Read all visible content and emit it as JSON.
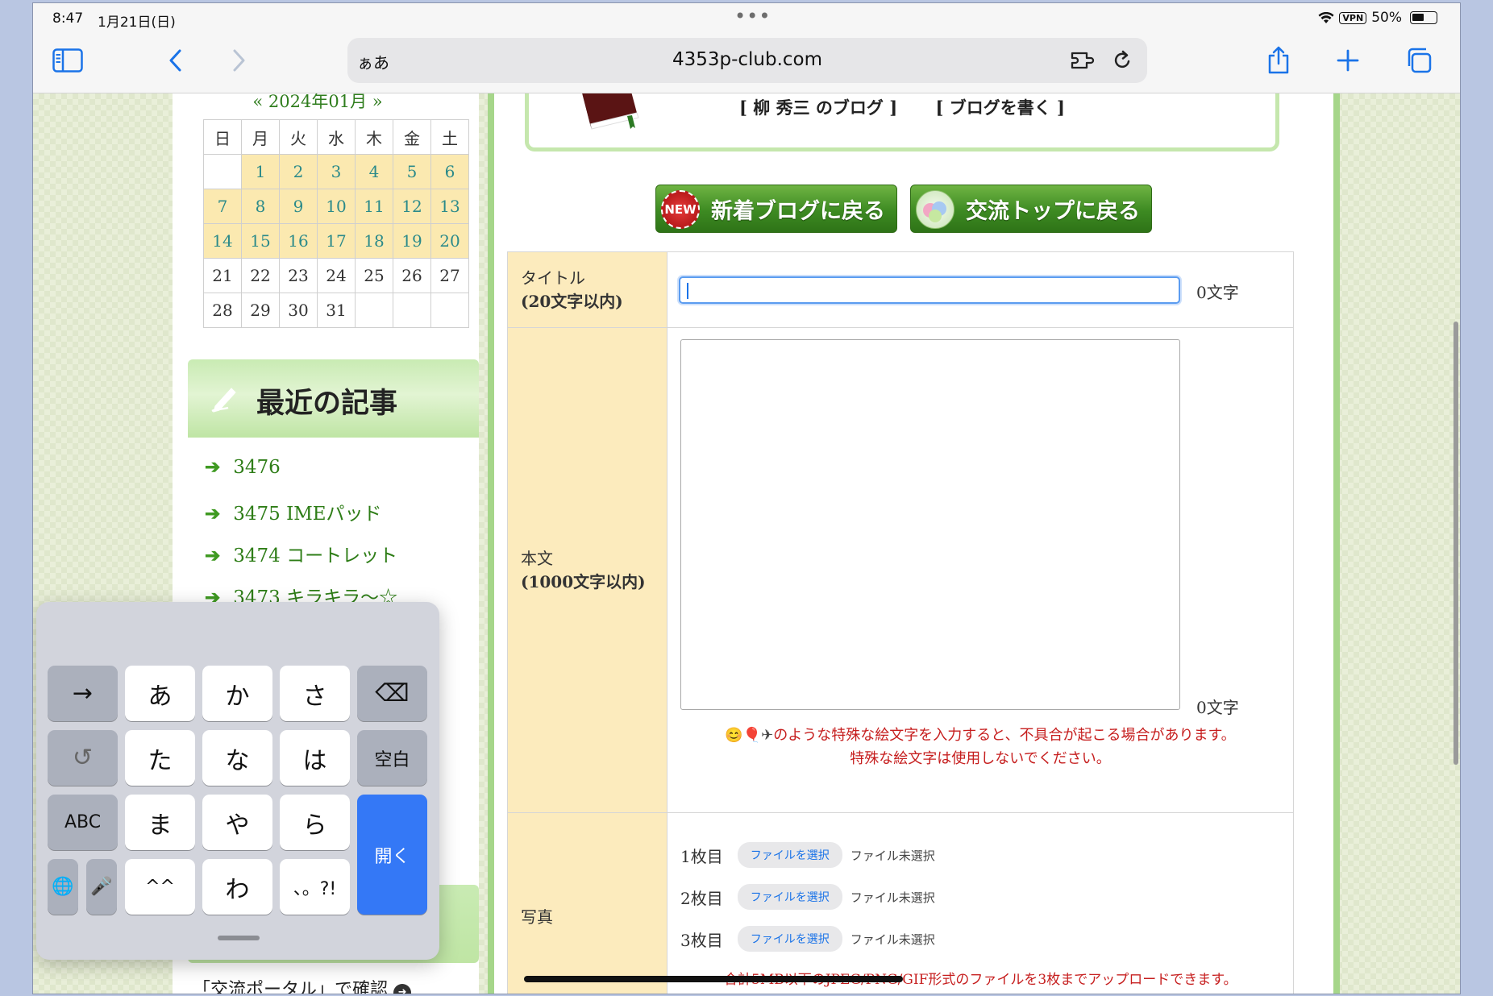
{
  "status_bar": {
    "time": "8:47",
    "date": "1月21日(日)",
    "vpn": "VPN",
    "battery": "50%"
  },
  "browser": {
    "aa_label": "ぁあ",
    "url": "4353p-club.com"
  },
  "calendar": {
    "title": "« 2024年01月 »",
    "weekdays": [
      "日",
      "月",
      "火",
      "水",
      "木",
      "金",
      "土"
    ],
    "weeks": [
      [
        "",
        "1",
        "2",
        "3",
        "4",
        "5",
        "6"
      ],
      [
        "7",
        "8",
        "9",
        "10",
        "11",
        "12",
        "13"
      ],
      [
        "14",
        "15",
        "16",
        "17",
        "18",
        "19",
        "20"
      ],
      [
        "21",
        "22",
        "23",
        "24",
        "25",
        "26",
        "27"
      ],
      [
        "28",
        "29",
        "30",
        "31",
        "",
        "",
        ""
      ]
    ]
  },
  "recent": {
    "heading": "最近の記事",
    "items": [
      "3476",
      "3475 IMEパッド",
      "3474 コートレット",
      "3473 キラキラ～☆"
    ]
  },
  "portal_link": "「交流ポータル」で確認",
  "blog": {
    "link1": "[ 柳 秀三 のブログ ]",
    "link2": "[ ブログを書く ]"
  },
  "buttons": {
    "new_blog": "新着ブログに戻る",
    "new_badge": "NEW",
    "kouryu_top": "交流トップに戻る"
  },
  "form": {
    "title_label": "タイトル",
    "title_limit": "(20文字以内)",
    "title_count": "0文字",
    "title_value": "",
    "body_label": "本文",
    "body_limit": "(1000文字以内)",
    "body_count": "0文字",
    "warning_emoji": "😊🎈✈",
    "warning_line1": "のような特殊な絵文字を入力すると、不具合が起こる場合があります。",
    "warning_line2": "特殊な絵文字は使用しないでください。",
    "photo_label": "写真",
    "photos": [
      {
        "label": "1枚目",
        "button": "ファイルを選択",
        "status": "ファイル未選択"
      },
      {
        "label": "2枚目",
        "button": "ファイルを選択",
        "status": "ファイル未選択"
      },
      {
        "label": "3枚目",
        "button": "ファイルを選択",
        "status": "ファイル未選択"
      }
    ],
    "photo_note": "合計5MB以下のJPEG/PNG/GIF形式のファイルを3枚までアップロードできます。"
  },
  "keyboard": {
    "keys": [
      "→",
      "あ",
      "か",
      "さ",
      "⌫",
      "↺",
      "た",
      "な",
      "は",
      "空白",
      "ABC",
      "ま",
      "や",
      "ら",
      "開く",
      "🌐",
      "🎤",
      "^^",
      "わ",
      "、。?!"
    ]
  }
}
